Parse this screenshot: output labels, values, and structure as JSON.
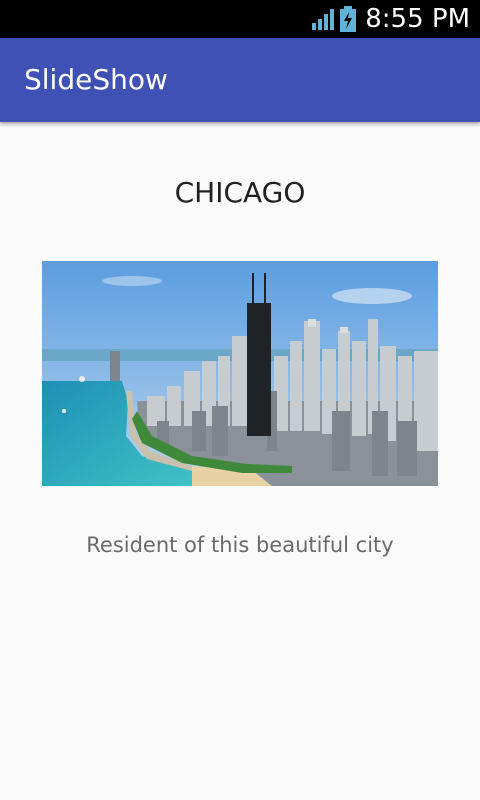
{
  "status_bar": {
    "time": "8:55 PM",
    "icons": [
      "signal-icon",
      "battery-charging-icon"
    ]
  },
  "app_bar": {
    "title": "SlideShow",
    "color": "#3f51b5"
  },
  "slide": {
    "title": "CHICAGO",
    "image_subject": "Chicago skyline aerial photo with lakefront beach",
    "caption": "Resident of this beautiful city"
  }
}
